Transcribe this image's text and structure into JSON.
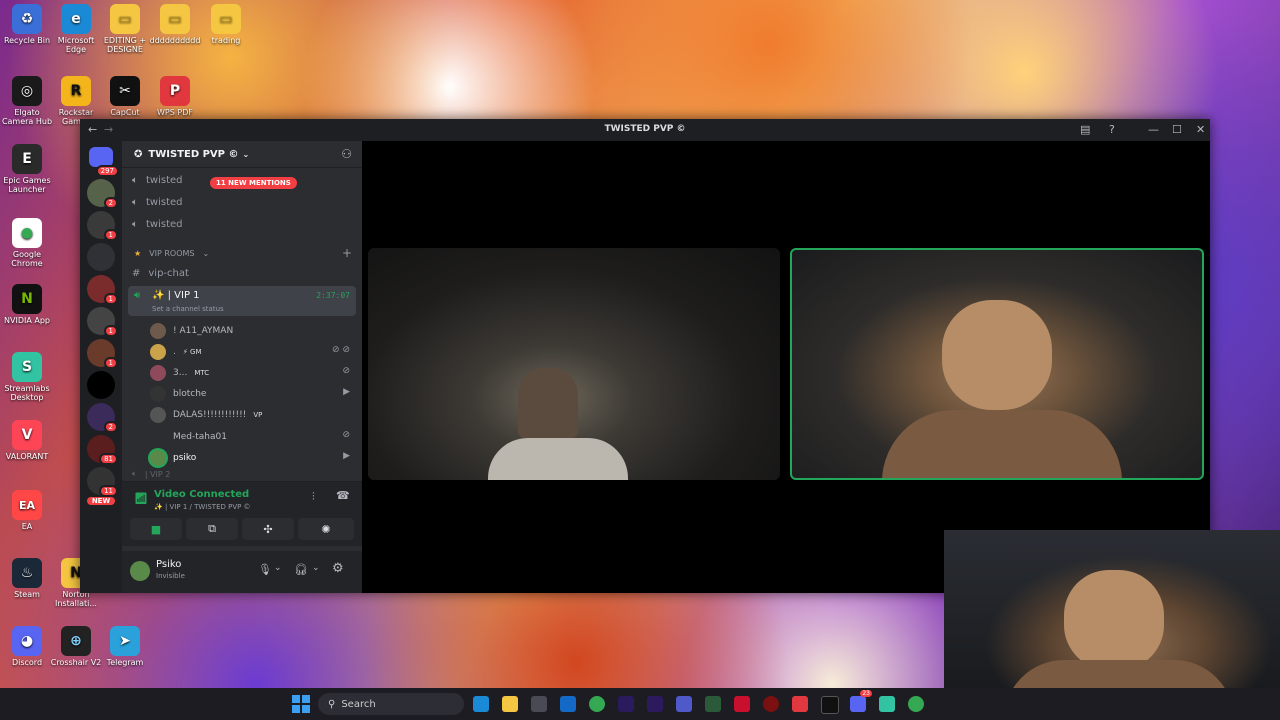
{
  "desktop": {
    "icons": [
      {
        "label": "Recycle Bin",
        "color": "#3a6fd8",
        "glyph": "♻"
      },
      {
        "label": "Microsoft Edge",
        "color": "#1b8ad6",
        "glyph": "e"
      },
      {
        "label": "EDITING + DESIGNE",
        "color": "#f5c642",
        "glyph": "▭"
      },
      {
        "label": "dddddddddd",
        "color": "#f5c642",
        "glyph": "▭"
      },
      {
        "label": "trading",
        "color": "#f5c642",
        "glyph": "▭"
      },
      {
        "label": "Elgato Camera Hub",
        "color": "#1a1a1a",
        "glyph": "◎"
      },
      {
        "label": "Rockstar Games",
        "color": "#f3b51b",
        "glyph": "R"
      },
      {
        "label": "CapCut",
        "color": "#111111",
        "glyph": "✂"
      },
      {
        "label": "WPS PDF",
        "color": "#e0383e",
        "glyph": "P"
      },
      {
        "label": "Epic Games Launcher",
        "color": "#2a2a2a",
        "glyph": "E"
      },
      {
        "label": "Google Chrome",
        "color": "#34a853",
        "glyph": "●"
      },
      {
        "label": "NVIDIA App",
        "color": "#76b900",
        "glyph": "N"
      },
      {
        "label": "Streamlabs Desktop",
        "color": "#31c3a2",
        "glyph": "S"
      },
      {
        "label": "VALORANT",
        "color": "#fd4556",
        "glyph": "V"
      },
      {
        "label": "EA",
        "color": "#ff4747",
        "glyph": "EA"
      },
      {
        "label": "Steam",
        "color": "#1b2838",
        "glyph": "♨"
      },
      {
        "label": "Norton Installati...",
        "color": "#f5c642",
        "glyph": "N"
      },
      {
        "label": "Discord",
        "color": "#5865f2",
        "glyph": "◕"
      },
      {
        "label": "Crosshair V2",
        "color": "#222222",
        "glyph": "⊕"
      },
      {
        "label": "Telegram",
        "color": "#2aa1da",
        "glyph": "➤"
      }
    ]
  },
  "window": {
    "title": "TWISTED PVP ©"
  },
  "guilds": {
    "dm_badge": "297",
    "badges": [
      "2",
      "1",
      "",
      "1",
      "1",
      "1",
      "",
      "2",
      "81",
      "11"
    ],
    "new_label": "NEW"
  },
  "server": {
    "name": "TWISTED PVP ©",
    "mentions_pill": "11 NEW MENTIONS",
    "voice_channels_top": [
      "twisted",
      "twisted",
      "twisted"
    ],
    "category": "VIP ROOMS",
    "text_channel": "vip-chat",
    "active_voice": {
      "name": "✨ | VIP 1",
      "timer": "2:37:07",
      "status_hint": "Set a channel status"
    },
    "members": [
      {
        "name": "! A11_AYMAN",
        "tag": "",
        "color": "#6d5a4a"
      },
      {
        "name": ".",
        "tag": "⚡ GM",
        "color": "#c9a24a"
      },
      {
        "name": "3...",
        "tag": "MTC",
        "color": "#8e4a5a"
      },
      {
        "name": "blotche",
        "tag": "",
        "color": "#333333"
      },
      {
        "name": "DALAS!!!!!!!!!!!!",
        "tag": "VP",
        "color": "#555555"
      },
      {
        "name": "Med-taha01",
        "tag": "",
        "color": "#2b2d31"
      },
      {
        "name": "psiko",
        "tag": "",
        "color": "#5a8a4a"
      }
    ],
    "next_channel_hint": "| VIP 2"
  },
  "voice": {
    "status": "Video Connected",
    "location": "✨ | VIP 1 / TWISTED PVP ©"
  },
  "user": {
    "name": "Psiko",
    "status": "Invisible"
  },
  "taskbar": {
    "search_placeholder": "Search",
    "discord_badge": "23"
  }
}
